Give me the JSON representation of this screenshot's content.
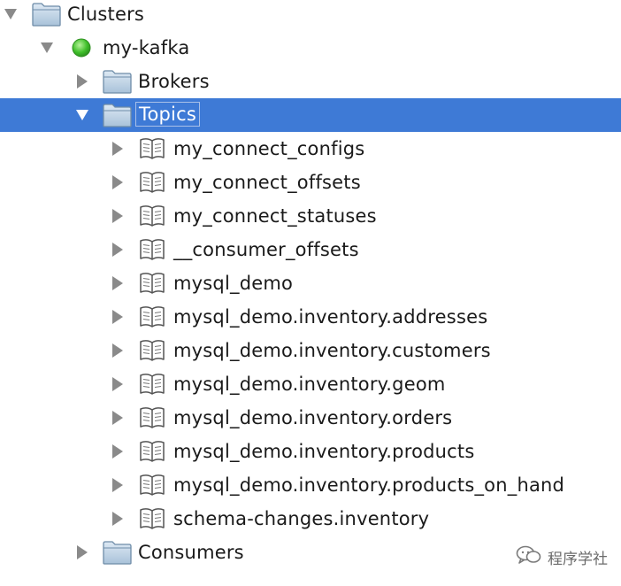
{
  "tree": {
    "root": {
      "label": "Clusters",
      "expanded": true
    },
    "cluster": {
      "label": "my-kafka",
      "expanded": true,
      "status": "connected",
      "status_color": "#3fbf2a"
    },
    "brokers": {
      "label": "Brokers",
      "expanded": false
    },
    "topics": {
      "label": "Topics",
      "expanded": true,
      "selected": true,
      "items": [
        {
          "label": "my_connect_configs"
        },
        {
          "label": "my_connect_offsets"
        },
        {
          "label": "my_connect_statuses"
        },
        {
          "label": "__consumer_offsets"
        },
        {
          "label": "mysql_demo"
        },
        {
          "label": "mysql_demo.inventory.addresses"
        },
        {
          "label": "mysql_demo.inventory.customers"
        },
        {
          "label": "mysql_demo.inventory.geom"
        },
        {
          "label": "mysql_demo.inventory.orders"
        },
        {
          "label": "mysql_demo.inventory.products"
        },
        {
          "label": "mysql_demo.inventory.products_on_hand"
        },
        {
          "label": "schema-changes.inventory"
        }
      ]
    },
    "consumers": {
      "label": "Consumers",
      "expanded": false
    }
  },
  "icons": {
    "folder": "folder-icon",
    "topic": "book-icon",
    "status": "status-dot-icon"
  },
  "colors": {
    "selection": "#3e7ad6",
    "text": "#1a1a1a",
    "selected_text": "#ffffff"
  },
  "watermark": {
    "text": "程序学社"
  }
}
